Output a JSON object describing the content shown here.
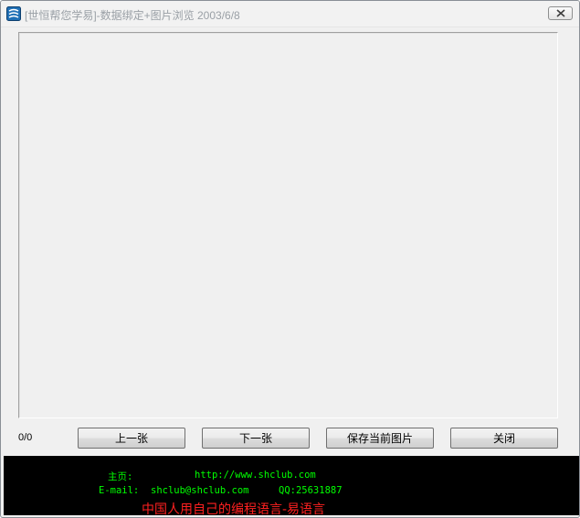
{
  "window": {
    "title": "[世恒帮您学易]-数据绑定+图片浏览  2003/6/8",
    "icon": "app-icon"
  },
  "viewer": {
    "counter": "0/0"
  },
  "buttons": {
    "prev": "上一张",
    "next": "下一张",
    "save": "保存当前图片",
    "close": "关闭"
  },
  "footer": {
    "homepage_label": "主页:",
    "homepage_url": "http://www.shclub.com",
    "email_label": "E-mail:",
    "email_value": "shclub@shclub.com",
    "qq": "QQ:25631887",
    "slogan": "中国人用自己的编程语言-易语言"
  },
  "colors": {
    "footer_bg": "#000000",
    "footer_text": "#00ff00",
    "slogan_text": "#ff2020",
    "window_bg": "#f0f0f0"
  }
}
